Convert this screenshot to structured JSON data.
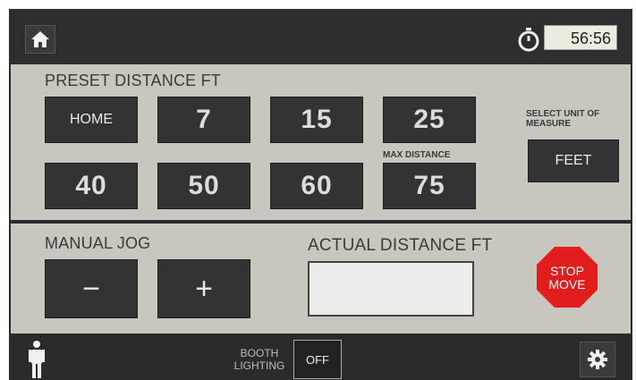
{
  "header": {
    "timer": "56:56"
  },
  "preset": {
    "title": "PRESET DISTANCE FT",
    "buttons": [
      "HOME",
      "7",
      "15",
      "25",
      "40",
      "50",
      "60",
      "75"
    ],
    "max_distance_label": "MAX DISTANCE",
    "unit_label": "SELECT UNIT OF MEASURE",
    "unit_value": "FEET"
  },
  "jog": {
    "title": "MANUAL JOG",
    "minus": "−",
    "plus": "+",
    "actual_title": "ACTUAL DISTANCE FT",
    "actual_value": "",
    "stop_line1": "STOP",
    "stop_line2": "MOVE"
  },
  "footer": {
    "booth_line1": "BOOTH",
    "booth_line2": "LIGHTING",
    "booth_state": "OFF"
  },
  "icons": [
    "home-icon",
    "stopwatch-icon",
    "person-icon",
    "gear-icon"
  ],
  "colors": {
    "stop": "#e11d1d",
    "panel": "#c9c7bd",
    "button": "#333333"
  }
}
